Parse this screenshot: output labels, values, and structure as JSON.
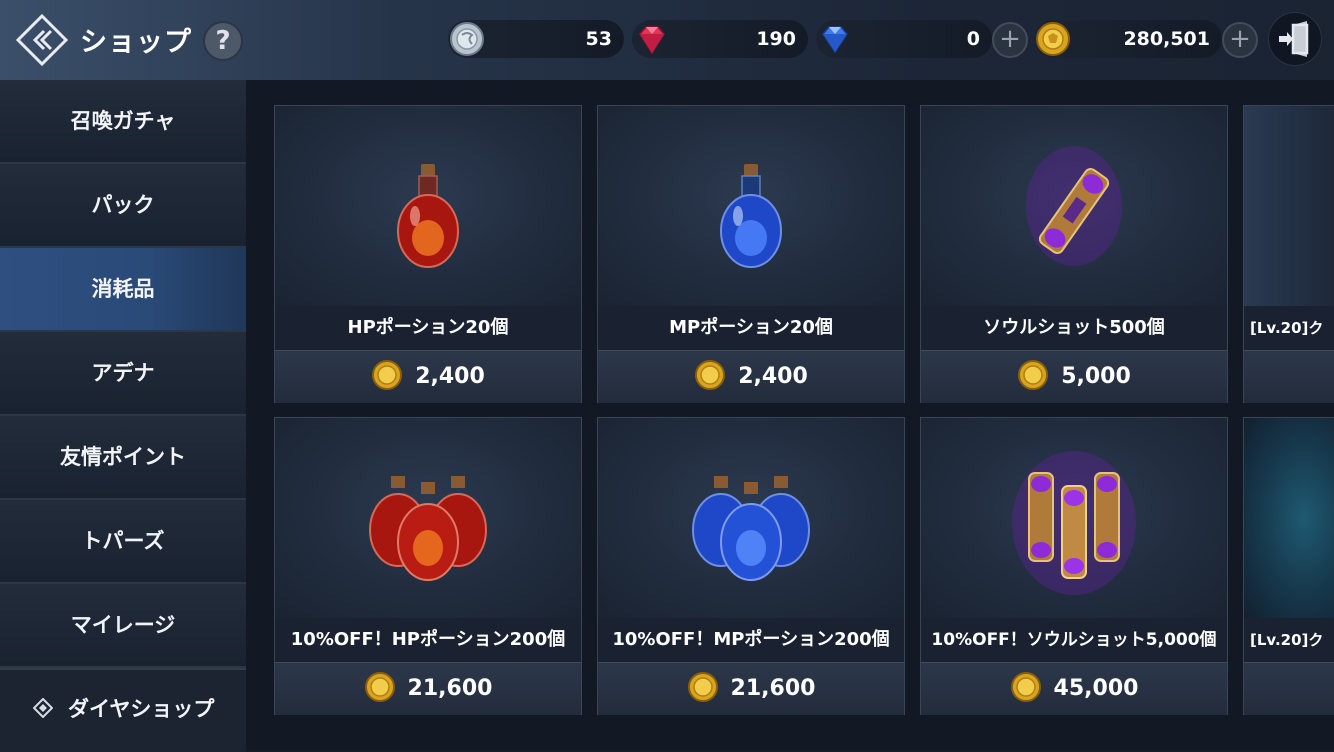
{
  "header": {
    "title": "ショップ",
    "help": "?",
    "currencies": [
      {
        "icon": "silver-coin-icon",
        "value": "53"
      },
      {
        "icon": "red-gem-icon",
        "value": "190"
      },
      {
        "icon": "blue-diamond-icon",
        "value": "0"
      },
      {
        "icon": "gold-coin-icon",
        "value": "280,501"
      }
    ],
    "plus": "+"
  },
  "sidebar": {
    "items": [
      {
        "label": "召喚ガチャ"
      },
      {
        "label": "パック"
      },
      {
        "label": "消耗品",
        "active": true
      },
      {
        "label": "アデナ"
      },
      {
        "label": "友情ポイント"
      },
      {
        "label": "トパーズ"
      },
      {
        "label": "マイレージ"
      }
    ],
    "bottom": "ダイヤショップ"
  },
  "products": [
    {
      "name": "HPポーション20個",
      "price": "2,400",
      "art": "red-potion-icon"
    },
    {
      "name": "MPポーション20個",
      "price": "2,400",
      "art": "blue-potion-icon"
    },
    {
      "name": "ソウルショット500個",
      "price": "5,000",
      "art": "soulshot-icon"
    },
    {
      "name": "10%OFF！HPポーション200個",
      "price": "21,600",
      "art": "red-potions-bundle-icon"
    },
    {
      "name": "10%OFF！MPポーション200個",
      "price": "21,600",
      "art": "blue-potions-bundle-icon"
    },
    {
      "name": "10%OFF！ソウルショット5,000個",
      "price": "45,000",
      "art": "soulshot-bundle-icon"
    }
  ],
  "partial_products": [
    {
      "name": "[Lv.20]ク"
    },
    {
      "name": "[Lv.20]ク"
    }
  ],
  "colors": {
    "accent": "#2e4f80",
    "gold": "#e0b52a",
    "background": "#121924"
  }
}
